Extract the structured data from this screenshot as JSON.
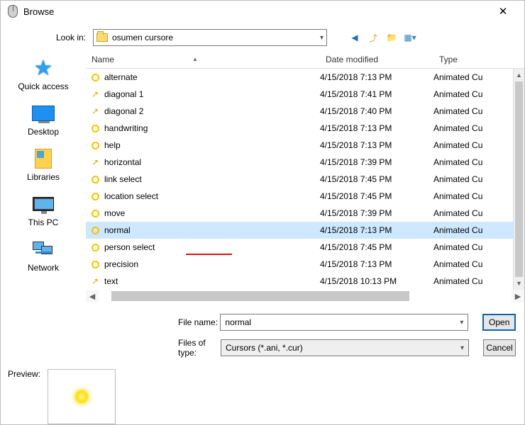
{
  "window": {
    "title": "Browse",
    "close": "✕"
  },
  "lookin": {
    "label": "Look in:",
    "value": "osumen cursore"
  },
  "toolbar_icons": [
    "back-icon",
    "up-icon",
    "new-folder-icon",
    "view-menu-icon"
  ],
  "places": [
    {
      "key": "quick",
      "label": "Quick access"
    },
    {
      "key": "desktop",
      "label": "Desktop"
    },
    {
      "key": "libraries",
      "label": "Libraries"
    },
    {
      "key": "thispc",
      "label": "This PC"
    },
    {
      "key": "network",
      "label": "Network"
    }
  ],
  "columns": {
    "name": "Name",
    "date": "Date modified",
    "type": "Type"
  },
  "files": [
    {
      "icon": "circle",
      "name": "alternate",
      "date": "4/15/2018 7:13 PM",
      "type": "Animated Cu"
    },
    {
      "icon": "arrow",
      "name": "diagonal 1",
      "date": "4/15/2018 7:41 PM",
      "type": "Animated Cu"
    },
    {
      "icon": "arrow",
      "name": "diagonal 2",
      "date": "4/15/2018 7:40 PM",
      "type": "Animated Cu"
    },
    {
      "icon": "circle",
      "name": "handwriting",
      "date": "4/15/2018 7:13 PM",
      "type": "Animated Cu"
    },
    {
      "icon": "circle",
      "name": "help",
      "date": "4/15/2018 7:13 PM",
      "type": "Animated Cu"
    },
    {
      "icon": "arrow",
      "name": "horizontal",
      "date": "4/15/2018 7:39 PM",
      "type": "Animated Cu"
    },
    {
      "icon": "circle",
      "name": "link select",
      "date": "4/15/2018 7:45 PM",
      "type": "Animated Cu"
    },
    {
      "icon": "circle",
      "name": "location select",
      "date": "4/15/2018 7:45 PM",
      "type": "Animated Cu"
    },
    {
      "icon": "circle",
      "name": "move",
      "date": "4/15/2018 7:39 PM",
      "type": "Animated Cu"
    },
    {
      "icon": "circle",
      "name": "normal",
      "date": "4/15/2018 7:13 PM",
      "type": "Animated Cu",
      "selected": true
    },
    {
      "icon": "circle",
      "name": "person select",
      "date": "4/15/2018 7:45 PM",
      "type": "Animated Cu"
    },
    {
      "icon": "circle",
      "name": "precision",
      "date": "4/15/2018 7:13 PM",
      "type": "Animated Cu"
    },
    {
      "icon": "arrow",
      "name": "text",
      "date": "4/15/2018 10:13 PM",
      "type": "Animated Cu"
    }
  ],
  "filename": {
    "label": "File name:",
    "value": "normal"
  },
  "filetype": {
    "label": "Files of type:",
    "value": "Cursors (*.ani, *.cur)"
  },
  "buttons": {
    "open": "Open",
    "cancel": "Cancel"
  },
  "preview": {
    "label": "Preview:"
  }
}
